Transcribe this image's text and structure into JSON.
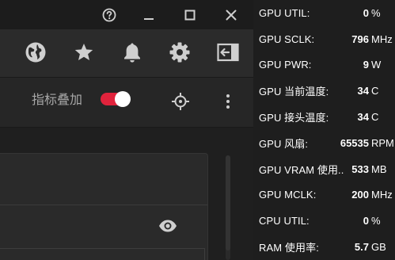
{
  "colors": {
    "accent": "#e0233c",
    "panel_bg": "#1e1e1e",
    "app_bg": "#232323",
    "icon": "#cfcfcf"
  },
  "titlebar": {
    "help_icon": "help-circle-icon",
    "minimize_icon": "minimize-icon",
    "maximize_icon": "maximize-icon",
    "close_icon": "close-icon"
  },
  "toolbar": {
    "icons": [
      "globe-icon",
      "star-icon",
      "bell-icon",
      "gear-icon",
      "panel-exit-icon"
    ]
  },
  "overlay": {
    "label": "指标叠加",
    "toggle_on": true
  },
  "stats": [
    {
      "label": "GPU UTIL:",
      "value": "0",
      "unit": "%"
    },
    {
      "label": "GPU SCLK:",
      "value": "796",
      "unit": "MHz"
    },
    {
      "label": "GPU PWR:",
      "value": "9",
      "unit": "W"
    },
    {
      "label": "GPU 当前温度:",
      "value": "34",
      "unit": "C"
    },
    {
      "label": "GPU 接头温度:",
      "value": "34",
      "unit": "C"
    },
    {
      "label": "GPU 风扇:",
      "value": "65535",
      "unit": "RPM"
    },
    {
      "label": "GPU VRAM 使用..",
      "value": "533",
      "unit": "MB"
    },
    {
      "label": "GPU MCLK:",
      "value": "200",
      "unit": "MHz"
    },
    {
      "label": "CPU UTIL:",
      "value": "0",
      "unit": "%"
    },
    {
      "label": "RAM 使用率:",
      "value": "5.7",
      "unit": "GB"
    }
  ]
}
